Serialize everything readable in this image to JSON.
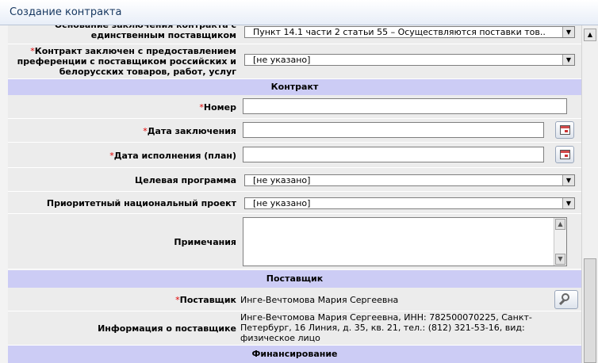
{
  "window": {
    "title": "Создание контракта"
  },
  "form": {
    "basis": {
      "label": "Основание заключения контракта с единственным поставщиком",
      "value": "Пункт 14.1 части 2 статьи 55 – Осуществляются поставки тов.."
    },
    "preference": {
      "required_mark": "*",
      "label": "Контракт заключен с предоставлением преференции с поставщиком российских и белорусских товаров, работ, услуг",
      "value": "[не указано]"
    }
  },
  "sections": {
    "contract": "Контракт",
    "supplier": "Поставщик",
    "financing": "Финансирование"
  },
  "contract": {
    "number": {
      "required_mark": "*",
      "label": "Номер",
      "value": ""
    },
    "date_signed": {
      "required_mark": "*",
      "label": "Дата заключения",
      "value": ""
    },
    "date_execution": {
      "required_mark": "*",
      "label": "Дата исполнения (план)",
      "value": ""
    },
    "target_program": {
      "label": "Целевая программа",
      "value": "[не указано]"
    },
    "national_project": {
      "label": "Приоритетный национальный проект",
      "value": "[не указано]"
    },
    "notes": {
      "label": "Примечания",
      "value": ""
    }
  },
  "supplier": {
    "supplier": {
      "required_mark": "*",
      "label": "Поставщик",
      "value": "Инге-Вечтомова Мария Сергеевна"
    },
    "info": {
      "label": "Информация о поставщике",
      "value": "Инге-Вечтомова Мария Сергеевна, ИНН: 782500070225, Санкт-Петербург, 16 Линия, д. 35, кв. 21, тел.: (812) 321-53-16, вид: физическое лицо"
    }
  },
  "icons": {
    "dropdown": "dropdown-arrow-icon",
    "calendar": "calendar-icon",
    "search": "search-icon"
  }
}
